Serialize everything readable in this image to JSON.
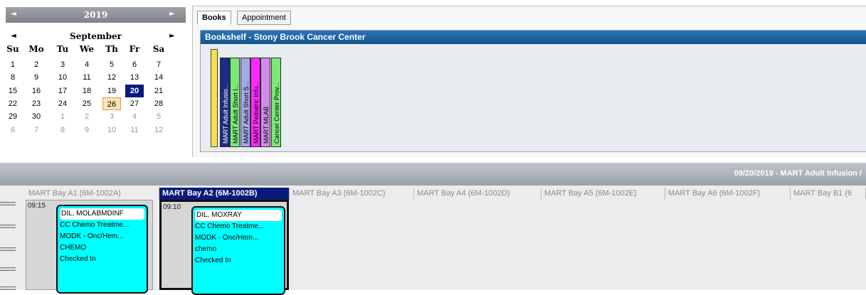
{
  "calendar": {
    "year": "2019",
    "month": "September",
    "weekdays": [
      "Su",
      "Mo",
      "Tu",
      "We",
      "Th",
      "Fr",
      "Sa"
    ],
    "weeks": [
      [
        "1",
        "2",
        "3",
        "4",
        "5",
        "6",
        "7"
      ],
      [
        "8",
        "9",
        "10",
        "11",
        "12",
        "13",
        "14"
      ],
      [
        "15",
        "16",
        "17",
        "18",
        "19",
        "20",
        "21"
      ],
      [
        "22",
        "23",
        "24",
        "25",
        "26",
        "27",
        "28"
      ],
      [
        "29",
        "30",
        "1",
        "2",
        "3",
        "4",
        "5"
      ],
      [
        "6",
        "7",
        "8",
        "9",
        "10",
        "11",
        "12"
      ]
    ],
    "selected_day": "20",
    "today_day": "26",
    "colors": {
      "selected": "#0b1a7a",
      "today": "#fbe1b5"
    }
  },
  "tabs": [
    {
      "label": "Books"
    },
    {
      "label": "Appointment"
    }
  ],
  "bookshelf": {
    "title": "Bookshelf - Stony Brook Cancer Center",
    "books": [
      {
        "label": "MART Adult Infusio...",
        "color": "#1c2a8a",
        "text_color": "#ffffff"
      },
      {
        "label": "MART Adult Short I...",
        "color": "#79e879",
        "text_color": "#000000"
      },
      {
        "label": "MART Adult Short S...",
        "color": "#a2a8e8",
        "text_color": "#000000"
      },
      {
        "label": "MART Pediatric Infu...",
        "color": "#ff2bff",
        "text_color": "#000000"
      },
      {
        "label": "MART MLAB",
        "color": "#d08ce8",
        "text_color": "#000000"
      },
      {
        "label": "Cancer Center Prov...",
        "color": "#7be878",
        "text_color": "#000000"
      }
    ]
  },
  "band": {
    "text": "09/20/2019 - MART Adult Infusion /"
  },
  "schedule": {
    "columns": [
      {
        "label": "MART Bay A1 (6M-1002A)",
        "active": false
      },
      {
        "label": "MART Bay A2 (6M-1002B)",
        "active": true
      },
      {
        "label": "MART Bay A3 (6M-1002C)",
        "active": false
      },
      {
        "label": "MART Bay A4 (6M-1002D)",
        "active": false
      },
      {
        "label": "MART Bay A5 (6M-1002E)",
        "active": false
      },
      {
        "label": "MART Bay A6 (6M-1002F)",
        "active": false
      },
      {
        "label": "MART Bay B1 (6",
        "active": false
      }
    ],
    "appointments": [
      {
        "time": "09:15",
        "lines": [
          "DIL, MOLABMDINF",
          "CC Chemo Treatme...",
          "MODK - Onc/Hem...",
          "CHEMO",
          "Checked In"
        ]
      },
      {
        "time": "09:10",
        "lines": [
          "DIL, MOXRAY",
          "CC Chemo Treatme...",
          "MODK - Onc/Hem...",
          "chemo",
          "Checked In"
        ]
      }
    ],
    "appointment_color": "#00ffff"
  }
}
